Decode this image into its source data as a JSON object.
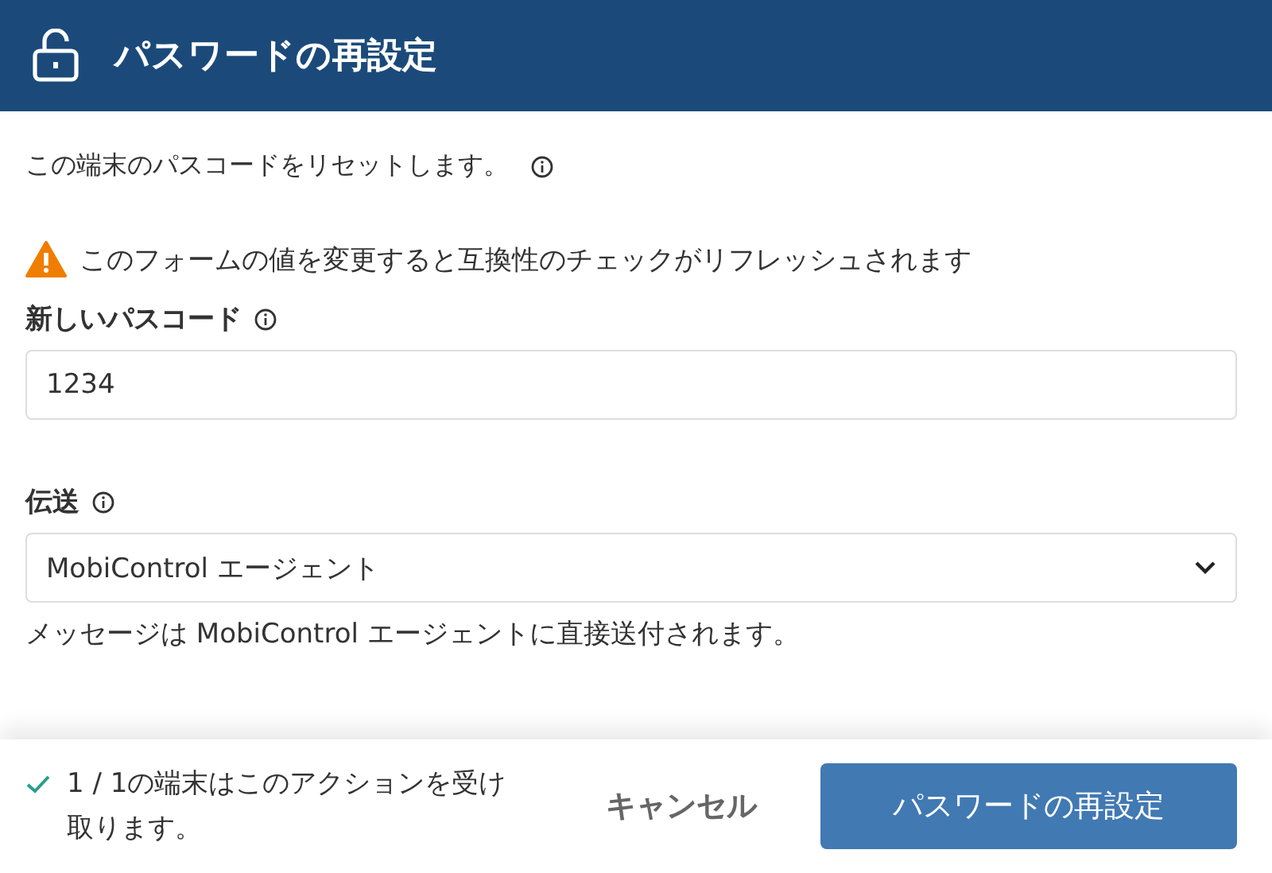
{
  "window": {
    "title": "パスワードの再設定"
  },
  "description": "この端末のパスコードをリセットします。",
  "warning": "このフォームの値を変更すると互換性のチェックがリフレッシュされます",
  "fields": [
    {
      "kind": "text",
      "label": "新しいパスコード",
      "value": "1234"
    },
    {
      "kind": "select",
      "label": "伝送",
      "value": "MobiControl エージェント",
      "help": "メッセージは MobiControl エージェントに直接送付されます。"
    }
  ],
  "footer": {
    "status": "1 / 1の端末はこのアクションを受け取ります。",
    "buttons": [
      {
        "kind": "text",
        "label": "キャンセル"
      },
      {
        "kind": "primary",
        "label": "パスワードの再設定"
      }
    ]
  }
}
